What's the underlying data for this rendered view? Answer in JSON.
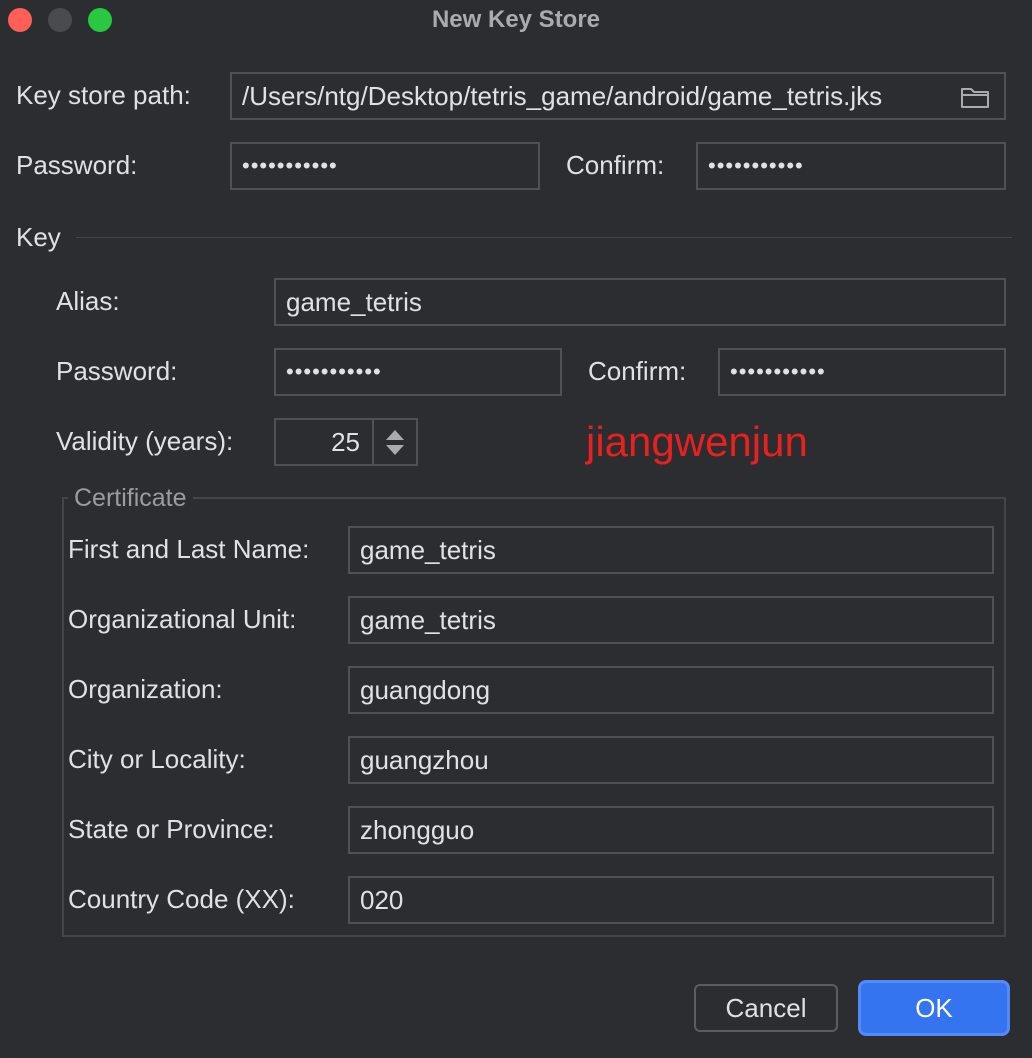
{
  "window": {
    "title": "New Key Store"
  },
  "keystore": {
    "path_label": "Key store path:",
    "path_value": "/Users/ntg/Desktop/tetris_game/android/game_tetris.jks",
    "password_label": "Password:",
    "password_value": "•••••••••••",
    "confirm_label": "Confirm:",
    "confirm_value": "•••••••••••"
  },
  "key": {
    "section_label": "Key",
    "alias_label": "Alias:",
    "alias_value": "game_tetris",
    "password_label": "Password:",
    "password_value": "•••••••••••",
    "confirm_label": "Confirm:",
    "confirm_value": "•••••••••••",
    "validity_label": "Validity (years):",
    "validity_value": "25"
  },
  "watermark": {
    "text": "jiangwenjun",
    "color": "#e8201e"
  },
  "certificate": {
    "title": "Certificate",
    "fields": [
      {
        "label": "First and Last Name:",
        "value": "game_tetris"
      },
      {
        "label": "Organizational Unit:",
        "value": "game_tetris"
      },
      {
        "label": "Organization:",
        "value": "guangdong"
      },
      {
        "label": "City or Locality:",
        "value": "guangzhou"
      },
      {
        "label": "State or Province:",
        "value": "zhongguo"
      },
      {
        "label": "Country Code (XX):",
        "value": "020"
      }
    ]
  },
  "buttons": {
    "cancel": "Cancel",
    "ok": "OK"
  },
  "icons": {
    "browse": "folder-icon"
  },
  "colors": {
    "accent": "#3574f0",
    "background": "#2b2d30"
  }
}
